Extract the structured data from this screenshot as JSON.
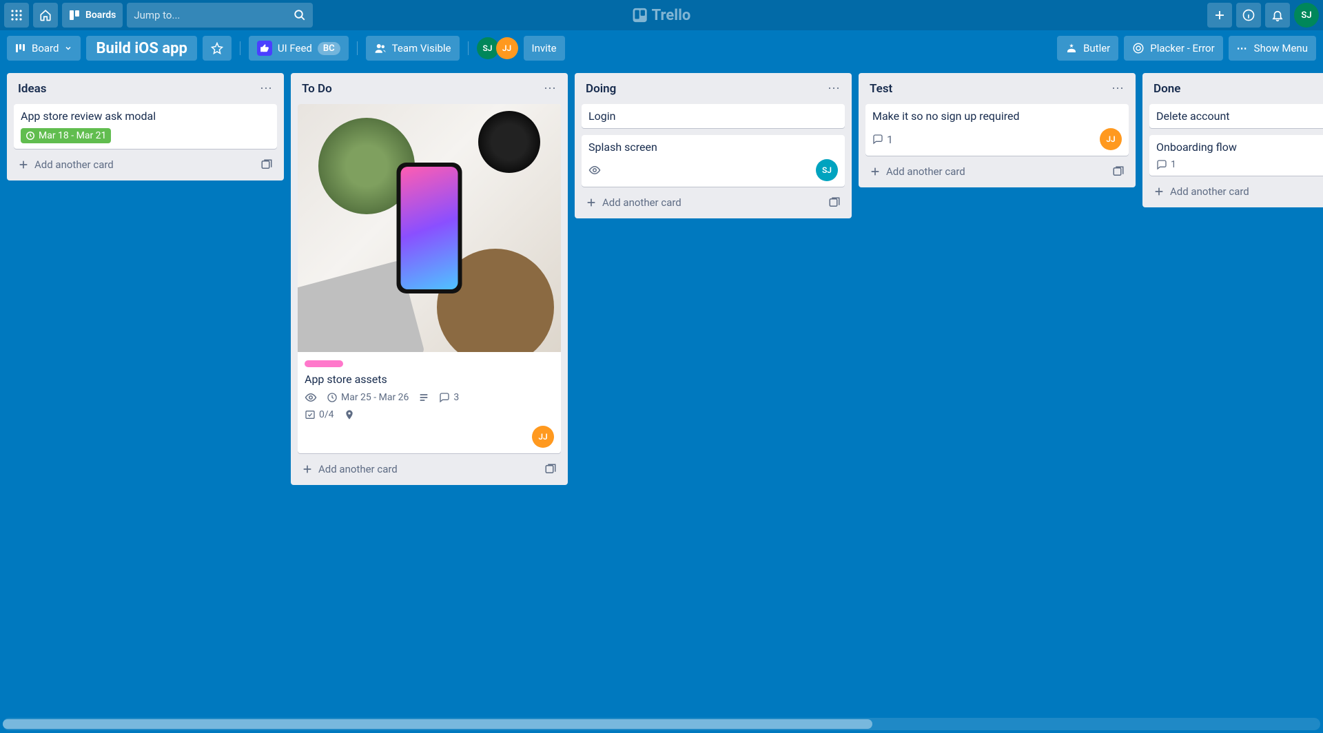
{
  "app": {
    "name": "Trello"
  },
  "header": {
    "boards_label": "Boards",
    "search_placeholder": "Jump to..."
  },
  "board_header": {
    "view_label": "Board",
    "title": "Build iOS app",
    "ui_feed_label": "UI Feed",
    "ui_feed_chip": "BC",
    "team_visible": "Team Visible",
    "invite": "Invite",
    "members": [
      {
        "initials": "SJ",
        "color": "#00875a"
      },
      {
        "initials": "JJ",
        "color": "#ff991f"
      }
    ],
    "butler": "Butler",
    "placker": "Placker - Error",
    "show_menu": "Show Menu"
  },
  "add_card_label": "Add another card",
  "lists": [
    {
      "title": "Ideas",
      "cards": [
        {
          "title": "App store review ask modal",
          "due_green": "Mar 18 - Mar 21"
        }
      ]
    },
    {
      "title": "To Do",
      "cards": [
        {
          "cover": true,
          "label_pink": true,
          "title": "App store assets",
          "watch": true,
          "due": "Mar 25 - Mar 26",
          "desc": true,
          "comments": "3",
          "checklist": "0/4",
          "location": true,
          "members": [
            {
              "initials": "JJ",
              "color": "#ff991f"
            }
          ]
        }
      ]
    },
    {
      "title": "Doing",
      "cards": [
        {
          "title": "Login"
        },
        {
          "title": "Splash screen",
          "watch": true,
          "members": [
            {
              "initials": "SJ",
              "color": "#00a3bf"
            }
          ]
        }
      ]
    },
    {
      "title": "Test",
      "cards": [
        {
          "title": "Make it so no sign up required",
          "comments": "1",
          "members": [
            {
              "initials": "JJ",
              "color": "#ff991f"
            }
          ]
        }
      ]
    },
    {
      "title": "Done",
      "cards": [
        {
          "title": "Delete account"
        },
        {
          "title": "Onboarding flow",
          "comments": "1"
        }
      ]
    }
  ],
  "header_avatar": {
    "initials": "SJ",
    "color": "#00875a"
  }
}
